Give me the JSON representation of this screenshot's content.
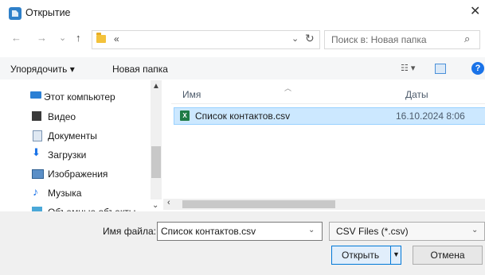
{
  "window": {
    "title": "Открытие",
    "close_glyph": "✕"
  },
  "nav": {
    "back_glyph": "←",
    "forward_glyph": "→",
    "recent_glyph": "⌄",
    "up_glyph": "↑",
    "address_crumb": "«",
    "address_dropdown_glyph": "⌄",
    "refresh_glyph": "↻",
    "search_placeholder": "Поиск в: Новая папка",
    "search_glyph": "⌕"
  },
  "toolbar": {
    "organize_label": "Упорядочить ▾",
    "new_folder_label": "Новая папка",
    "view_glyph": "☷ ▾",
    "help_glyph": "?"
  },
  "sidebar": {
    "items": [
      {
        "label": "Этот компьютер",
        "icon": "computer-icon"
      },
      {
        "label": "Видео",
        "icon": "video-icon"
      },
      {
        "label": "Документы",
        "icon": "documents-icon"
      },
      {
        "label": "Загрузки",
        "icon": "downloads-icon"
      },
      {
        "label": "Изображения",
        "icon": "pictures-icon"
      },
      {
        "label": "Музыка",
        "icon": "music-icon"
      },
      {
        "label": "Объемные объекты",
        "icon": "3d-objects-icon"
      }
    ]
  },
  "file_list": {
    "columns": {
      "name": "Имя",
      "date": "Даты"
    },
    "rows": [
      {
        "name": "Список контактов.csv",
        "date": "16.10.2024 8:06",
        "icon": "excel-csv-icon",
        "selected": true
      }
    ]
  },
  "footer": {
    "filename_label": "Имя файла:",
    "filename_value": "Список контактов.csv",
    "filetype_value": "CSV Files (*.csv)",
    "open_label": "Открыть",
    "cancel_label": "Отмена"
  },
  "colors": {
    "accent": "#0078d7",
    "selection": "#cce8ff",
    "excel_green": "#1f7b45"
  }
}
